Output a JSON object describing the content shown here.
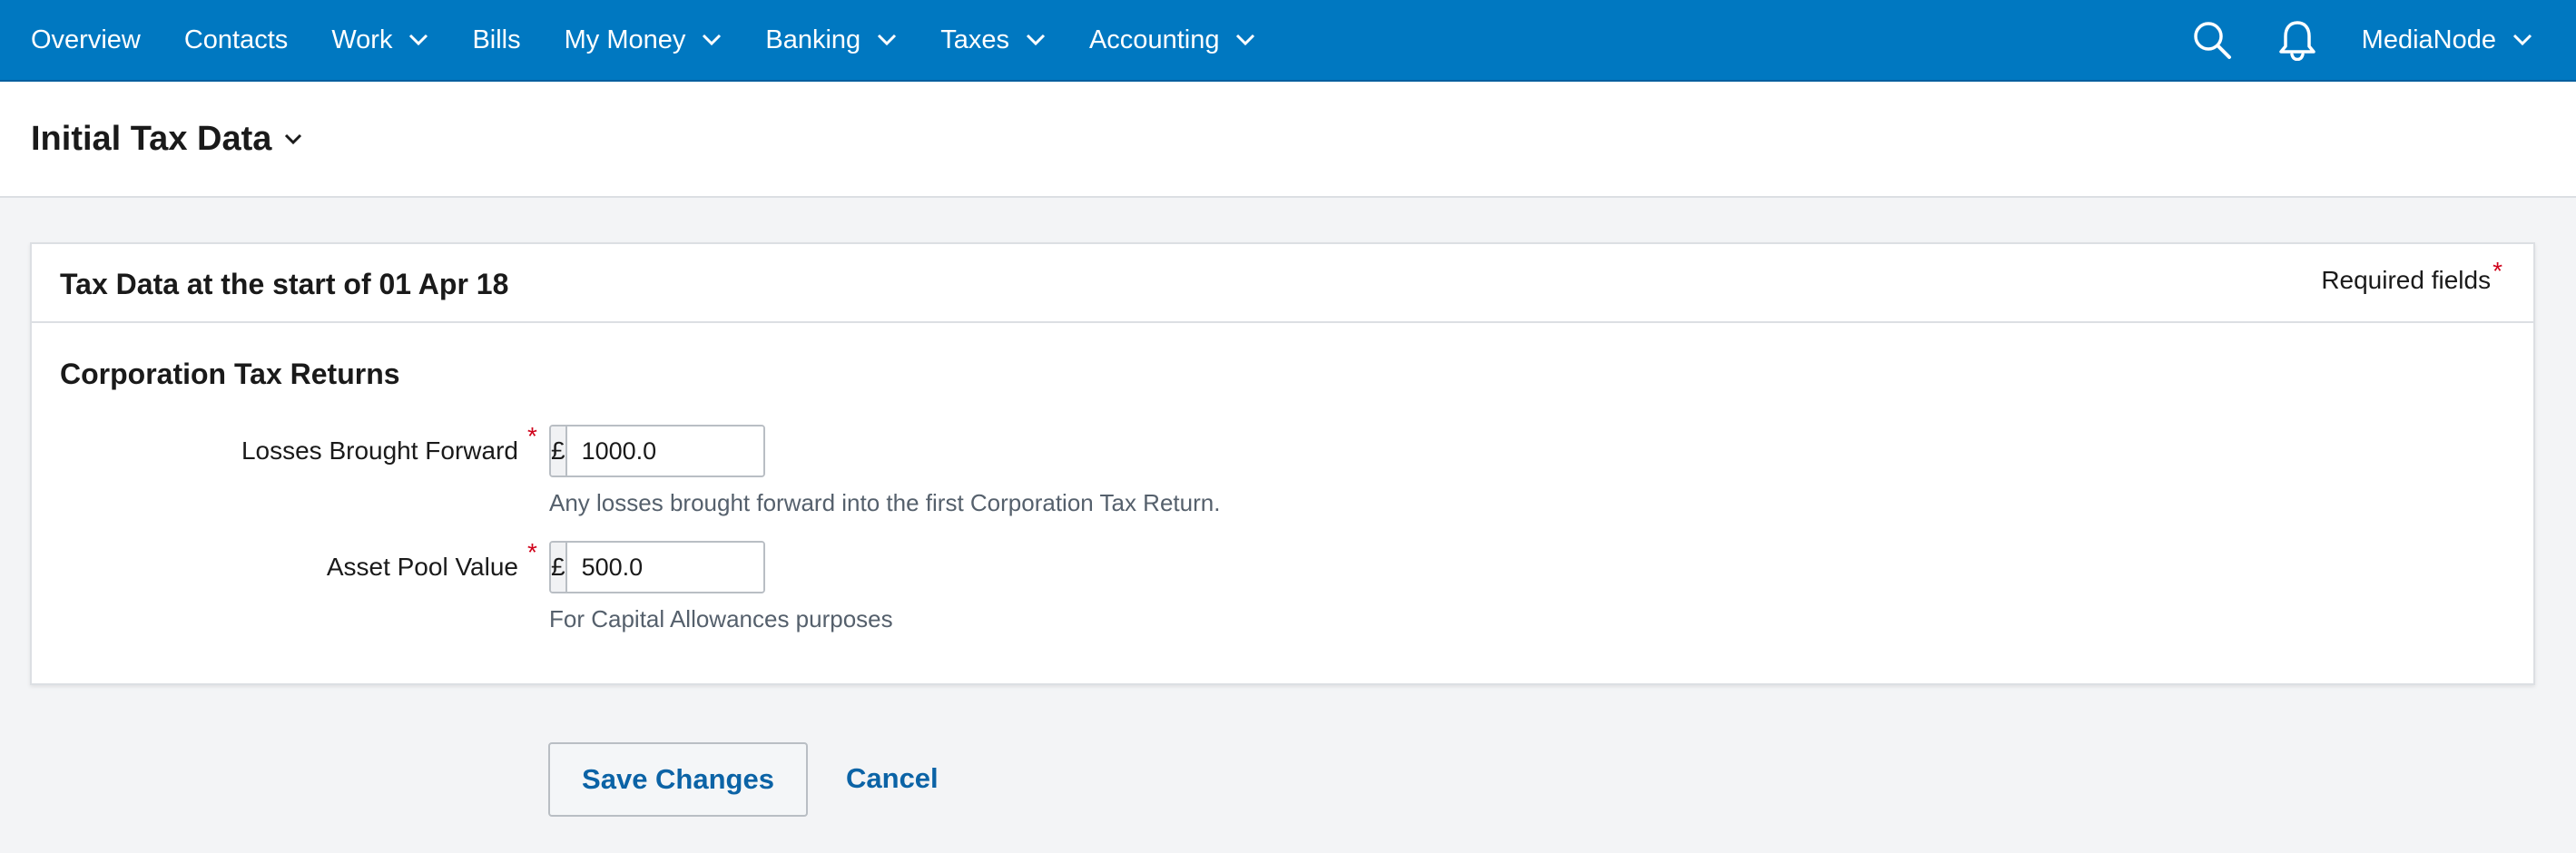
{
  "nav": {
    "items": [
      {
        "label": "Overview",
        "has_dropdown": false
      },
      {
        "label": "Contacts",
        "has_dropdown": false
      },
      {
        "label": "Work",
        "has_dropdown": true
      },
      {
        "label": "Bills",
        "has_dropdown": false
      },
      {
        "label": "My Money",
        "has_dropdown": true
      },
      {
        "label": "Banking",
        "has_dropdown": true
      },
      {
        "label": "Taxes",
        "has_dropdown": true
      },
      {
        "label": "Accounting",
        "has_dropdown": true
      }
    ],
    "account_name": "MediaNode",
    "icons": [
      "search-icon",
      "bell-icon"
    ],
    "bar_color": "#0078c1"
  },
  "page": {
    "title": "Initial Tax Data"
  },
  "card": {
    "title": "Tax Data at the start of 01 Apr 18",
    "required_note": "Required fields",
    "required_star": "*",
    "section_title": "Corporation Tax Returns",
    "fields": [
      {
        "label": "Losses Brought Forward",
        "currency": "£",
        "value": "1000.0",
        "help": "Any losses brought forward into the first Corporation Tax Return."
      },
      {
        "label": "Asset Pool Value",
        "currency": "£",
        "value": "500.0",
        "help": "For Capital Allowances purposes"
      }
    ]
  },
  "actions": {
    "save_label": "Save Changes",
    "cancel_label": "Cancel"
  }
}
